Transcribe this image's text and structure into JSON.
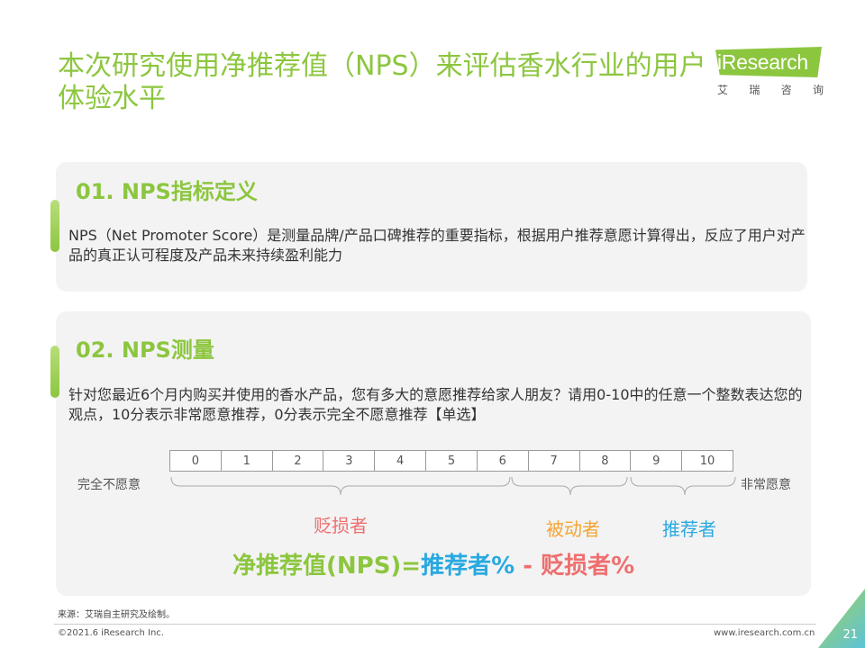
{
  "header": {
    "title": "本次研究使用净推荐值（NPS）来评估香水行业的用户体验水平"
  },
  "logo": {
    "name": "iResearch",
    "subtitle": [
      "艾",
      "瑞",
      "咨",
      "询"
    ]
  },
  "section1": {
    "title": "01. NPS指标定义",
    "body": "NPS（Net Promoter Score）是测量品牌/产品口碑推荐的重要指标，根据用户推荐意愿计算得出，反应了用户对产品的真正认可程度及产品未来持续盈利能力"
  },
  "section2": {
    "title": "02. NPS测量",
    "question": "针对您最近6个月内购买并使用的香水产品，您有多大的意愿推荐给家人朋友？请用0-10中的任意一个整数表达您的观点，10分表示非常愿意推荐，0分表示完全不愿意推荐【单选】",
    "scale": [
      "0",
      "1",
      "2",
      "3",
      "4",
      "5",
      "6",
      "7",
      "8",
      "9",
      "10"
    ],
    "label_left": "完全不愿意",
    "label_right": "非常愿意",
    "categories": {
      "detractors": "贬损者",
      "passives": "被动者",
      "promoters": "推荐者"
    },
    "formula": {
      "lhs": "净推荐值(NPS)=",
      "promoters": "推荐者%",
      "minus": " - ",
      "detractors": "贬损者%"
    }
  },
  "footer": {
    "source": "来源：艾瑞自主研究及绘制。",
    "copyright": "©2021.6 iResearch Inc.",
    "website": "www.iresearch.com.cn",
    "page": "21"
  },
  "colors": {
    "brand_green": "#8cc63f",
    "detractor_red": "#ef6f6f",
    "passive_orange": "#f4a534",
    "promoter_blue": "#29a9e1"
  }
}
